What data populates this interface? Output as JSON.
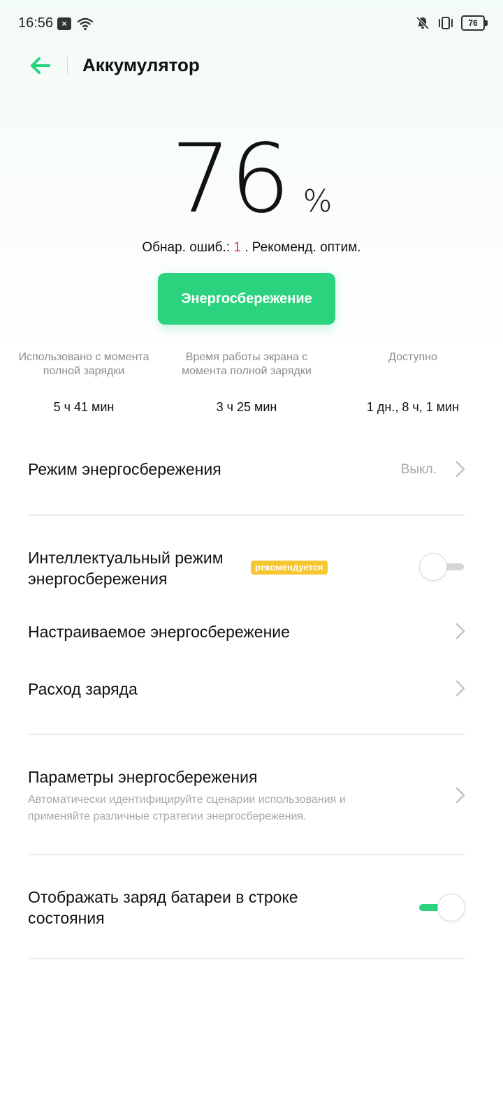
{
  "status_bar": {
    "time": "16:56",
    "notification_icon": "close-square-icon",
    "battery_level": "76"
  },
  "header": {
    "title": "Аккумулятор",
    "back_icon": "arrow-left-icon",
    "accent_color": "#2bd37f"
  },
  "battery": {
    "percent": "76",
    "unit": "%"
  },
  "error_line": {
    "prefix": "Обнар. ошиб.: ",
    "count": "1",
    "suffix": " . Рекоменд. оптим."
  },
  "primary_button": {
    "label": "Энергосбережение"
  },
  "stats": [
    {
      "label": "Использовано с момента полной зарядки",
      "value": "5 ч 41 мин"
    },
    {
      "label": "Время работы экрана с момента полной зарядки",
      "value": "3 ч 25 мин"
    },
    {
      "label": "Доступно",
      "value": "1 дн., 8 ч, 1 мин"
    }
  ],
  "settings": {
    "power_saving_mode": {
      "title": "Режим энергосбережения",
      "value": "Выкл."
    },
    "smart_power_saving": {
      "title_line1": "Интеллектуальный режим",
      "title_line2": "энергосбережения",
      "badge": "рекомендуется",
      "enabled": false
    },
    "custom_power_saving": {
      "title": "Настраиваемое энергосбережение"
    },
    "battery_usage": {
      "title": "Расход заряда"
    },
    "power_saving_params": {
      "title": "Параметры энергосбережения",
      "subtitle_line1": "Автоматически идентифицируйте сценарии использования и",
      "subtitle_line2": "применяйте различные стратегии энергосбережения."
    },
    "show_battery_percent": {
      "title_line1": "Отображать заряд батареи в строке",
      "title_line2": "состояния",
      "enabled": true
    }
  }
}
